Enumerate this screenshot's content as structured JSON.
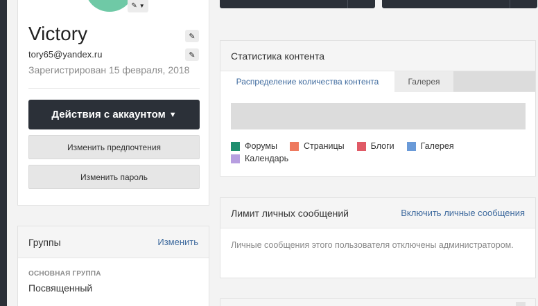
{
  "profile": {
    "name": "Victory",
    "email": "tory65@yandex.ru",
    "registered": "Зарегистрирован 15 февраля, 2018",
    "avatar_color": "#6fc9a6",
    "edit_icon": "pencil-icon",
    "account_actions_label": "Действия с аккаунтом",
    "change_preferences_label": "Изменить предпочтения",
    "change_password_label": "Изменить пароль"
  },
  "groups": {
    "title": "Группы",
    "edit_label": "Изменить",
    "primary_group_label": "ОСНОВНАЯ ГРУППА",
    "primary_group_value": "Посвященный"
  },
  "content_stats": {
    "title": "Статистика контента",
    "tabs": [
      {
        "label": "Распределение количества контента",
        "active": true
      },
      {
        "label": "Галерея",
        "active": false
      }
    ],
    "legend": [
      {
        "label": "Форумы",
        "color": "#1e8e6e"
      },
      {
        "label": "Страницы",
        "color": "#ee7a5f"
      },
      {
        "label": "Блоги",
        "color": "#e05a66"
      },
      {
        "label": "Галерея",
        "color": "#6a9ad8"
      },
      {
        "label": "Календарь",
        "color": "#b79ee0"
      }
    ]
  },
  "messages": {
    "title": "Лимит личных сообщений",
    "enable_label": "Включить личные сообщения",
    "body": "Личные сообщения этого пользователя отключены администратором."
  },
  "colors": {
    "dark": "#2b3038",
    "link": "#3e6a9e",
    "muted": "#8a8a8a"
  }
}
